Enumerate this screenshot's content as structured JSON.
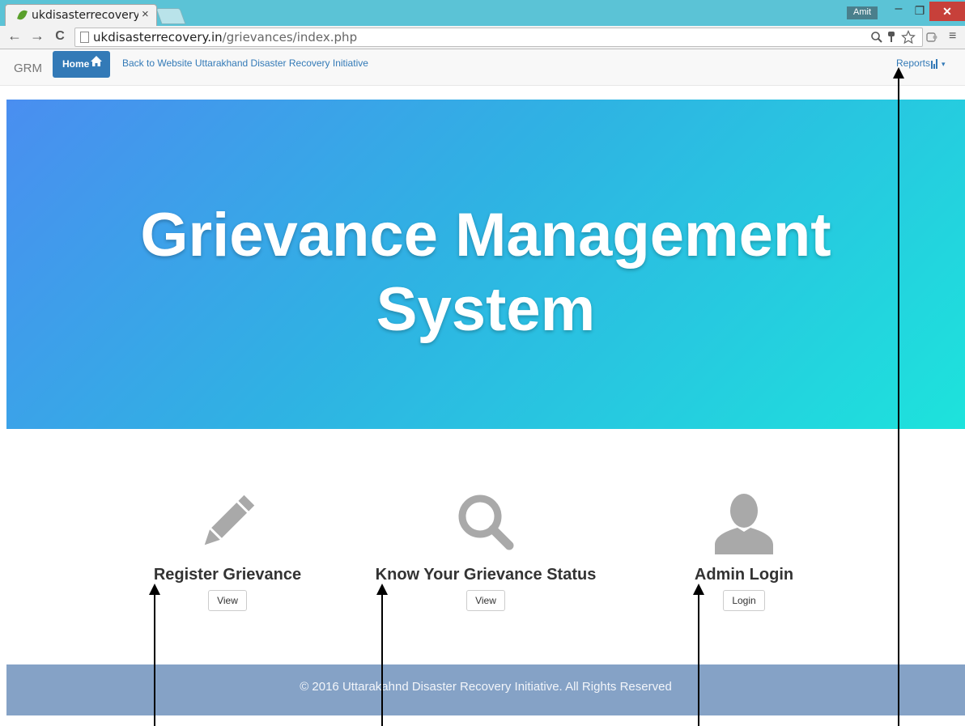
{
  "browser": {
    "tab_title": "ukdisasterrecovery.in",
    "tab_close": "×",
    "user_badge": "Amit",
    "window_controls": {
      "minimize": "‒",
      "maximize": "❐",
      "close": "✕"
    },
    "nav": {
      "back": "←",
      "forward": "→",
      "reload": "C"
    },
    "url_host": "ukdisasterrecovery.in",
    "url_path": "/grievances/index.php",
    "omnibox_icons": [
      "zoom-icon",
      "key-icon",
      "star-icon",
      "extension-icon"
    ],
    "menu_icon": "≡"
  },
  "navbar": {
    "brand": "GRM",
    "home_label": "Home",
    "home_icon": "home-icon",
    "back_link": "Back to Website Uttarakhand Disaster Recovery Initiative",
    "reports_label": "Reports",
    "reports_caret": "▾"
  },
  "hero": {
    "title_line1": "Grievance Management",
    "title_line2": "System",
    "gradient_colors": [
      "#4a8ef0",
      "#2fb2e3",
      "#1de3dc"
    ]
  },
  "features": [
    {
      "icon": "pencil-icon",
      "title": "Register Grievance",
      "button": "View"
    },
    {
      "icon": "search-icon",
      "title": "Know Your Grievance Status",
      "button": "View"
    },
    {
      "icon": "user-icon",
      "title": "Admin Login",
      "button": "Login"
    }
  ],
  "footer": {
    "text": "© 2016 Uttarakahnd Disaster Recovery Initiative. All Rights Reserved"
  },
  "colors": {
    "link": "#337ab7",
    "footer_bg": "#85a2c6",
    "icon_gray": "#a9a9a9"
  }
}
